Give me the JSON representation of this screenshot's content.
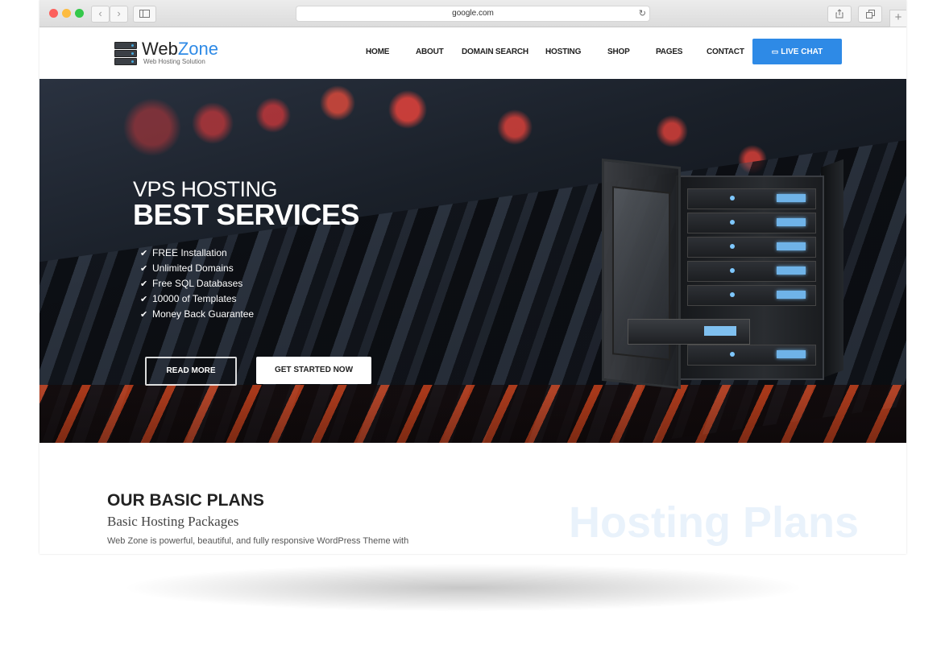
{
  "browser": {
    "url": "google.com",
    "back_icon": "chevron-left-icon",
    "forward_icon": "chevron-right-icon",
    "sidebar_icon": "sidebar-icon",
    "share_icon": "share-icon",
    "tabs_icon": "tabs-icon",
    "new_tab": "+"
  },
  "site": {
    "logo": {
      "name_dark": "Web",
      "name_accent": "Zone",
      "tagline": "Web Hosting Solution"
    },
    "nav": [
      {
        "label": "HOME",
        "dropdown": true
      },
      {
        "label": "ABOUT",
        "dropdown": false
      },
      {
        "label": "DOMAIN SEARCH",
        "dropdown": false
      },
      {
        "label": "HOSTING",
        "dropdown": true
      },
      {
        "label": "SHOP",
        "dropdown": true
      },
      {
        "label": "PAGES",
        "dropdown": true
      },
      {
        "label": "CONTACT",
        "dropdown": false
      }
    ],
    "live_chat": "LIVE CHAT",
    "accent_color": "#2e8ae6"
  },
  "hero": {
    "subtitle": "VPS HOSTING",
    "title": "BEST SERVICES",
    "features": [
      "FREE Installation",
      "Unlimited Domains",
      "Free SQL Databases",
      "10000 of Templates",
      "Money Back Guarantee"
    ],
    "read_more": "READ MORE",
    "get_started": "GET STARTED NOW"
  },
  "plans": {
    "title": "OUR BASIC PLANS",
    "subtitle": "Basic Hosting Packages",
    "description": "Web Zone is powerful, beautiful, and fully responsive WordPress Theme with",
    "watermark": "Hosting Plans"
  }
}
